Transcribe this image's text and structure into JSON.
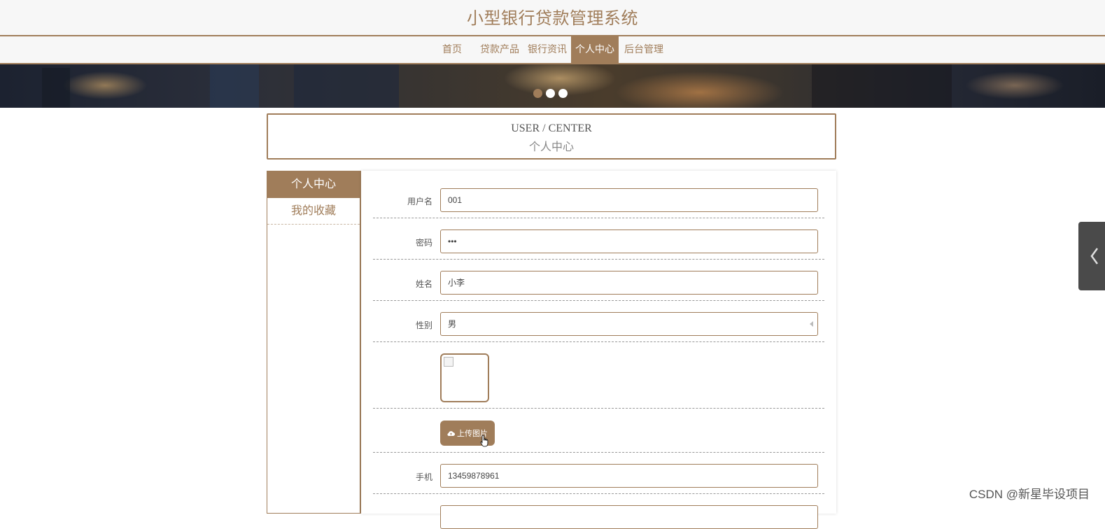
{
  "site": {
    "title": "小型银行贷款管理系统"
  },
  "nav": {
    "items": [
      {
        "label": "首页",
        "active": false
      },
      {
        "label": "贷款产品",
        "active": false
      },
      {
        "label": "银行资讯",
        "active": false
      },
      {
        "label": "个人中心",
        "active": true
      },
      {
        "label": "后台管理",
        "active": false
      }
    ]
  },
  "carousel": {
    "dots": 3,
    "active_index": 0
  },
  "section": {
    "title_en": "USER / CENTER",
    "title_cn": "个人中心"
  },
  "sidebar": {
    "items": [
      {
        "label": "个人中心",
        "active": true
      },
      {
        "label": "我的收藏",
        "active": false
      }
    ]
  },
  "form": {
    "username": {
      "label": "用户名",
      "value": "001"
    },
    "password": {
      "label": "密码",
      "value": "•••"
    },
    "name": {
      "label": "姓名",
      "value": "小李"
    },
    "gender": {
      "label": "性别",
      "value": "男"
    },
    "upload_label": "上传图片",
    "phone": {
      "label": "手机",
      "value": "13459878961"
    }
  },
  "watermark": "CSDN @新星毕设项目",
  "colors": {
    "accent": "#a07d5a",
    "background": "#ffffff",
    "handle": "#4a4a4a"
  }
}
